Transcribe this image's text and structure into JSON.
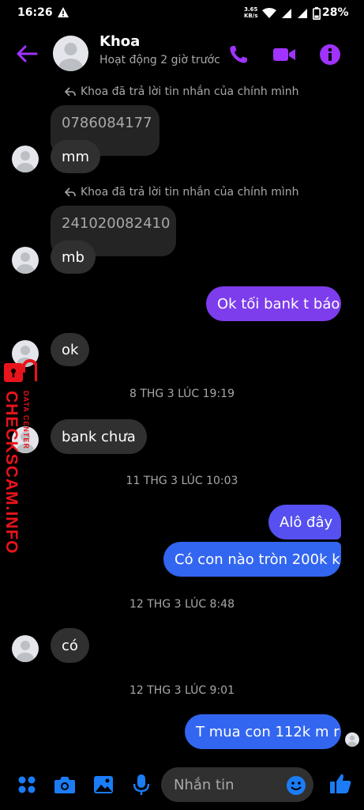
{
  "status_bar": {
    "time": "16:26",
    "net_speed_value": "3.65",
    "net_speed_unit": "KB/s",
    "battery": "28%"
  },
  "header": {
    "name": "Khoa",
    "activity": "Hoạt động 2 giờ trước",
    "accent_color": "#a033ff"
  },
  "messages": {
    "reply_note_1": "Khoa đã trả lời tin nhắn của chính mình",
    "quote_1": "0786084177",
    "msg_1": "mm",
    "reply_note_2": "Khoa đã trả lời tin nhắn của chính mình",
    "quote_2": "241020082410",
    "msg_2": "mb",
    "msg_3": "Ok tối bank t báo",
    "msg_4": "ok",
    "divider_1": "8 THG 3 LÚC 19:19",
    "msg_5": "bank chưa",
    "divider_2": "11 THG 3 LÚC 10:03",
    "msg_6": "Alô đây",
    "msg_7": "Có con nào tròn 200k k",
    "divider_3": "12 THG 3 LÚC 8:48",
    "msg_8": "có",
    "divider_4": "12 THG 3 LÚC 9:01",
    "msg_9": "T mua con 112k m r"
  },
  "watermark": {
    "main": "CHECKSCAM.INFO",
    "sub": "DATA CENTER"
  },
  "composer": {
    "placeholder": "Nhắn tin"
  },
  "icons": [
    "back-arrow-icon",
    "phone-icon",
    "video-icon",
    "info-icon",
    "apps-icon",
    "camera-icon",
    "gallery-icon",
    "microphone-icon",
    "emoji-icon",
    "thumbs-up-icon"
  ]
}
